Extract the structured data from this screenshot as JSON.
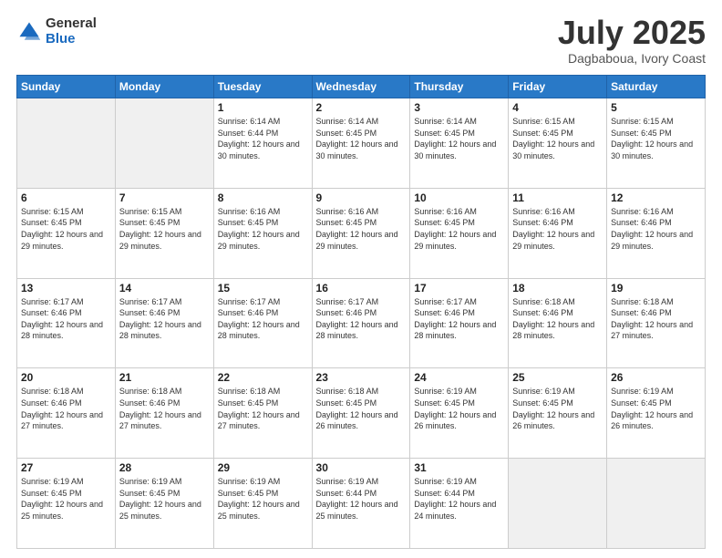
{
  "logo": {
    "general": "General",
    "blue": "Blue"
  },
  "header": {
    "month": "July 2025",
    "location": "Dagbaboua, Ivory Coast"
  },
  "weekdays": [
    "Sunday",
    "Monday",
    "Tuesday",
    "Wednesday",
    "Thursday",
    "Friday",
    "Saturday"
  ],
  "weeks": [
    [
      {
        "day": "",
        "empty": true
      },
      {
        "day": "",
        "empty": true
      },
      {
        "day": "1",
        "sunrise": "6:14 AM",
        "sunset": "6:44 PM",
        "daylight": "12 hours and 30 minutes."
      },
      {
        "day": "2",
        "sunrise": "6:14 AM",
        "sunset": "6:45 PM",
        "daylight": "12 hours and 30 minutes."
      },
      {
        "day": "3",
        "sunrise": "6:14 AM",
        "sunset": "6:45 PM",
        "daylight": "12 hours and 30 minutes."
      },
      {
        "day": "4",
        "sunrise": "6:15 AM",
        "sunset": "6:45 PM",
        "daylight": "12 hours and 30 minutes."
      },
      {
        "day": "5",
        "sunrise": "6:15 AM",
        "sunset": "6:45 PM",
        "daylight": "12 hours and 30 minutes."
      }
    ],
    [
      {
        "day": "6",
        "sunrise": "6:15 AM",
        "sunset": "6:45 PM",
        "daylight": "12 hours and 29 minutes."
      },
      {
        "day": "7",
        "sunrise": "6:15 AM",
        "sunset": "6:45 PM",
        "daylight": "12 hours and 29 minutes."
      },
      {
        "day": "8",
        "sunrise": "6:16 AM",
        "sunset": "6:45 PM",
        "daylight": "12 hours and 29 minutes."
      },
      {
        "day": "9",
        "sunrise": "6:16 AM",
        "sunset": "6:45 PM",
        "daylight": "12 hours and 29 minutes."
      },
      {
        "day": "10",
        "sunrise": "6:16 AM",
        "sunset": "6:45 PM",
        "daylight": "12 hours and 29 minutes."
      },
      {
        "day": "11",
        "sunrise": "6:16 AM",
        "sunset": "6:46 PM",
        "daylight": "12 hours and 29 minutes."
      },
      {
        "day": "12",
        "sunrise": "6:16 AM",
        "sunset": "6:46 PM",
        "daylight": "12 hours and 29 minutes."
      }
    ],
    [
      {
        "day": "13",
        "sunrise": "6:17 AM",
        "sunset": "6:46 PM",
        "daylight": "12 hours and 28 minutes."
      },
      {
        "day": "14",
        "sunrise": "6:17 AM",
        "sunset": "6:46 PM",
        "daylight": "12 hours and 28 minutes."
      },
      {
        "day": "15",
        "sunrise": "6:17 AM",
        "sunset": "6:46 PM",
        "daylight": "12 hours and 28 minutes."
      },
      {
        "day": "16",
        "sunrise": "6:17 AM",
        "sunset": "6:46 PM",
        "daylight": "12 hours and 28 minutes."
      },
      {
        "day": "17",
        "sunrise": "6:17 AM",
        "sunset": "6:46 PM",
        "daylight": "12 hours and 28 minutes."
      },
      {
        "day": "18",
        "sunrise": "6:18 AM",
        "sunset": "6:46 PM",
        "daylight": "12 hours and 28 minutes."
      },
      {
        "day": "19",
        "sunrise": "6:18 AM",
        "sunset": "6:46 PM",
        "daylight": "12 hours and 27 minutes."
      }
    ],
    [
      {
        "day": "20",
        "sunrise": "6:18 AM",
        "sunset": "6:46 PM",
        "daylight": "12 hours and 27 minutes."
      },
      {
        "day": "21",
        "sunrise": "6:18 AM",
        "sunset": "6:46 PM",
        "daylight": "12 hours and 27 minutes."
      },
      {
        "day": "22",
        "sunrise": "6:18 AM",
        "sunset": "6:45 PM",
        "daylight": "12 hours and 27 minutes."
      },
      {
        "day": "23",
        "sunrise": "6:18 AM",
        "sunset": "6:45 PM",
        "daylight": "12 hours and 26 minutes."
      },
      {
        "day": "24",
        "sunrise": "6:19 AM",
        "sunset": "6:45 PM",
        "daylight": "12 hours and 26 minutes."
      },
      {
        "day": "25",
        "sunrise": "6:19 AM",
        "sunset": "6:45 PM",
        "daylight": "12 hours and 26 minutes."
      },
      {
        "day": "26",
        "sunrise": "6:19 AM",
        "sunset": "6:45 PM",
        "daylight": "12 hours and 26 minutes."
      }
    ],
    [
      {
        "day": "27",
        "sunrise": "6:19 AM",
        "sunset": "6:45 PM",
        "daylight": "12 hours and 25 minutes."
      },
      {
        "day": "28",
        "sunrise": "6:19 AM",
        "sunset": "6:45 PM",
        "daylight": "12 hours and 25 minutes."
      },
      {
        "day": "29",
        "sunrise": "6:19 AM",
        "sunset": "6:45 PM",
        "daylight": "12 hours and 25 minutes."
      },
      {
        "day": "30",
        "sunrise": "6:19 AM",
        "sunset": "6:44 PM",
        "daylight": "12 hours and 25 minutes."
      },
      {
        "day": "31",
        "sunrise": "6:19 AM",
        "sunset": "6:44 PM",
        "daylight": "12 hours and 24 minutes."
      },
      {
        "day": "",
        "empty": true
      },
      {
        "day": "",
        "empty": true
      }
    ]
  ]
}
